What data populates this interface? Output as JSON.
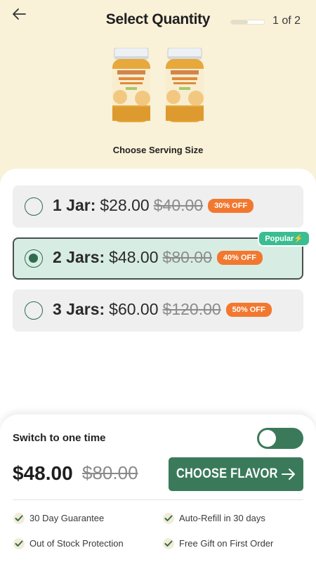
{
  "header": {
    "title": "Select Quantity",
    "step_text": "1 of 2",
    "progress": 0.5
  },
  "hero": {
    "product_icon": "sea-moss-jar-icon",
    "jar_brand": "TRUE SEA MOSS",
    "jar_product": "Sea Moss Gel Superfood",
    "subtitle": "Choose Serving Size"
  },
  "options": [
    {
      "qty": "1 Jar:",
      "price": "$28.00",
      "original": "$40.00",
      "badge": "30% OFF",
      "selected": false
    },
    {
      "qty": "2 Jars:",
      "price": "$48.00",
      "original": "$80.00",
      "badge": "40% OFF",
      "selected": true,
      "tag": "Popular⚡"
    },
    {
      "qty": "3 Jars:",
      "price": "$60.00",
      "original": "$120.00",
      "badge": "50% OFF",
      "selected": false
    }
  ],
  "bottom": {
    "switch_label": "Switch to one time",
    "toggle_on": true,
    "total": "$48.00",
    "total_original": "$80.00",
    "cta_label": "CHOOSE FLAVOR",
    "perks": [
      "30 Day Guarantee",
      "Auto-Refill in 30 days",
      "Out of Stock Protection",
      "Free Gift on First Order"
    ]
  },
  "colors": {
    "hero_bg": "#f9f1d8",
    "brand_green": "#3a7a5a",
    "selected_bg": "#d7ede3",
    "badge_orange": "#f2782f",
    "popular_green": "#3bbd92"
  }
}
